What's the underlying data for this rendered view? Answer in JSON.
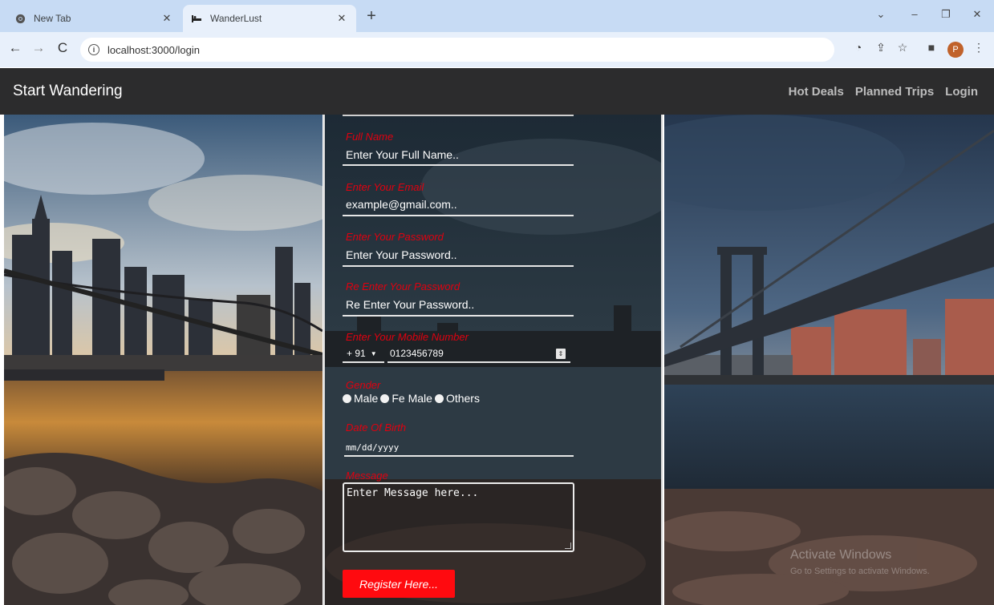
{
  "browser": {
    "tabs": [
      {
        "title": "New Tab",
        "icon": "chrome-icon"
      },
      {
        "title": "WanderLust",
        "icon": "wander-icon"
      }
    ],
    "url": "localhost:3000/login",
    "profile_initial": "P"
  },
  "site": {
    "brand": "Start Wandering",
    "nav": [
      "Hot Deals",
      "Planned Trips",
      "Login"
    ]
  },
  "form": {
    "full_name": {
      "label": "Full Name",
      "placeholder": "Enter Your Full Name.."
    },
    "email": {
      "label": "Enter Your Email",
      "placeholder": "example@gmail.com.."
    },
    "password": {
      "label": "Enter Your Password",
      "placeholder": "Enter Your Password.."
    },
    "confirm_password": {
      "label": "Re Enter Your Password",
      "placeholder": "Re Enter Your Password.."
    },
    "mobile": {
      "label": "Enter Your Mobile Number",
      "code": "+ 91",
      "placeholder": "0123456789"
    },
    "gender": {
      "label": "Gender",
      "options": [
        "Male",
        "Fe Male",
        "Others"
      ]
    },
    "dob": {
      "label": "Date Of Birth",
      "placeholder": "mm/dd/yyyy"
    },
    "message": {
      "label": "Message",
      "placeholder": "Enter Message here..."
    },
    "submit_label": "Register Here..."
  },
  "watermark": {
    "title": "Activate Windows",
    "subtitle": "Go to Settings to activate Windows."
  },
  "colors": {
    "accent": "#ff0a0f",
    "label": "#e0000f",
    "navbar": "#2c2c2d"
  }
}
